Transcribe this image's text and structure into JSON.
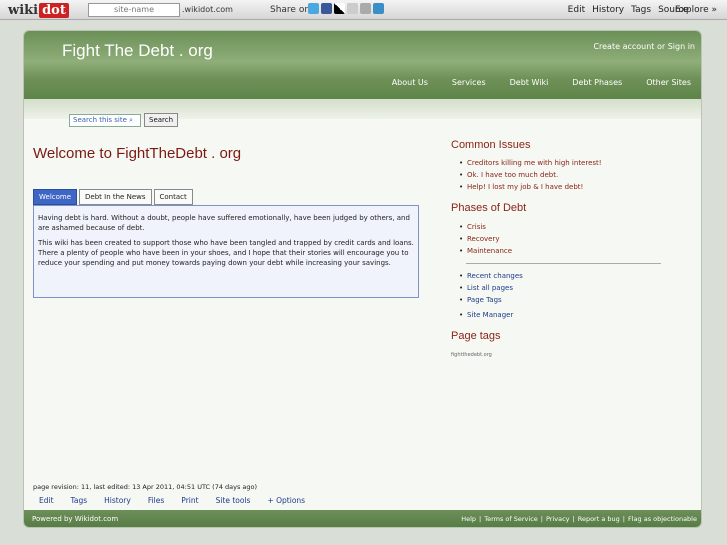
{
  "wikidot_bar": {
    "logo_text": "wiki",
    "logo_dot": "dot",
    "site_placeholder": "site-name",
    "domain_suffix": ".wikidot.com",
    "share_label": "Share on",
    "menu": [
      "Edit",
      "History",
      "Tags",
      "Source"
    ],
    "explore": "Explore »"
  },
  "header": {
    "site_title": "Fight The Debt . org",
    "account": "Create account or Sign in",
    "nav": [
      "About Us",
      "Services",
      "Debt Wiki",
      "Debt Phases",
      "Other Sites"
    ]
  },
  "search": {
    "placeholder": "Search this site",
    "button": "Search"
  },
  "main": {
    "title": "Welcome to FightTheDebt . org",
    "tabs": [
      "Welcome",
      "Debt In the News",
      "Contact"
    ],
    "paragraphs": [
      "Having debt is hard. Without a doubt, people have suffered emotionally, have been judged by others, and are ashamed because of debt.",
      "This wiki has been created to support those who have been tangled and trapped by credit cards and loans. There a plenty of people who have been in your shoes, and I hope that their stories will encourage you to reduce your spending and put money towards paying down your debt while increasing your savings."
    ]
  },
  "sidebar": {
    "common_heading": "Common Issues",
    "common_items": [
      "Creditors killing me with high interest!",
      "Ok. I have too much debt.",
      "Help! I lost my job & I have debt!"
    ],
    "phases_heading": "Phases of Debt",
    "phases_items": [
      "Crisis",
      "Recovery",
      "Maintenance"
    ],
    "wiki_items": [
      "Recent changes",
      "List all pages",
      "Page Tags"
    ],
    "manager": "Site Manager",
    "tags_heading": "Page tags",
    "tags_text": "fightthedebt.org"
  },
  "bottom": {
    "revision": "page revision: 11, last edited: 13 Apr 2011, 04:51 UTC (74 days ago)",
    "options": [
      "Edit",
      "Tags",
      "History",
      "Files",
      "Print",
      "Site tools",
      "+ Options"
    ]
  },
  "footer": {
    "powered": "Powered by Wikidot.com",
    "links": [
      "Help",
      "|",
      "Terms of Service",
      "|",
      "Privacy",
      "|",
      "Report a bug",
      "|",
      "Flag as objectionable"
    ]
  },
  "colors": {
    "header_green": "#6c8f58",
    "tab_blue": "#3d66c5",
    "title_red": "#7b1a12"
  }
}
